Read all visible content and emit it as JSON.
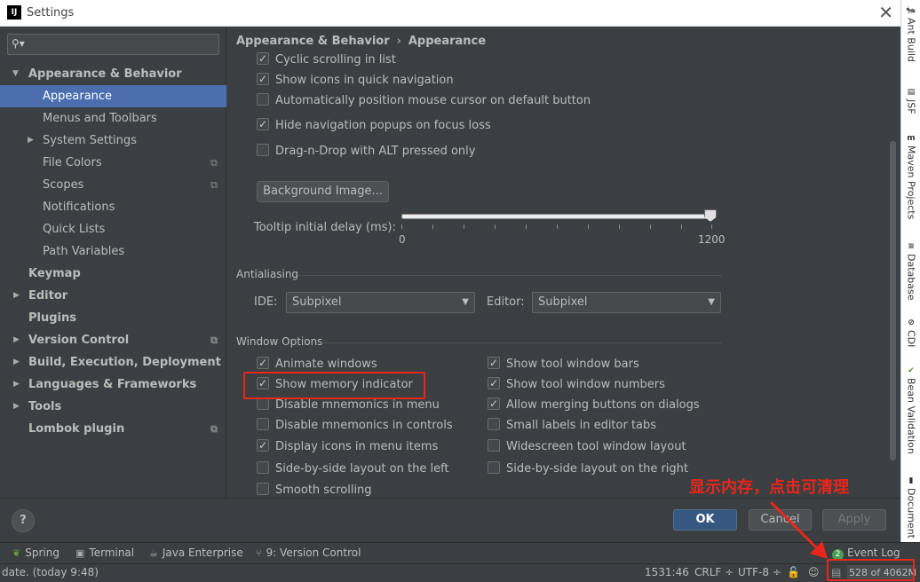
{
  "window": {
    "title": "Settings",
    "icon": "intellij-icon"
  },
  "right_tool_strip": [
    {
      "label": "Ant Build",
      "icon": "ant-icon"
    },
    {
      "label": "JSF",
      "icon": "jsf-icon"
    },
    {
      "label": "Maven Projects",
      "icon": "maven-icon"
    },
    {
      "label": "Database",
      "icon": "database-icon"
    },
    {
      "label": "CDI",
      "icon": "cdi-icon"
    },
    {
      "label": "Bean Validation",
      "icon": "bean-validation-icon"
    },
    {
      "label": "Document",
      "icon": "document-icon"
    }
  ],
  "search": {
    "placeholder": "",
    "value": ""
  },
  "sidebar": {
    "items": [
      {
        "label": "Appearance & Behavior"
      },
      {
        "label": "Appearance"
      },
      {
        "label": "Menus and Toolbars"
      },
      {
        "label": "System Settings"
      },
      {
        "label": "File Colors"
      },
      {
        "label": "Scopes"
      },
      {
        "label": "Notifications"
      },
      {
        "label": "Quick Lists"
      },
      {
        "label": "Path Variables"
      },
      {
        "label": "Keymap"
      },
      {
        "label": "Editor"
      },
      {
        "label": "Plugins"
      },
      {
        "label": "Version Control"
      },
      {
        "label": "Build, Execution, Deployment"
      },
      {
        "label": "Languages & Frameworks"
      },
      {
        "label": "Tools"
      },
      {
        "label": "Lombok plugin"
      }
    ]
  },
  "breadcrumb": {
    "parent": "Appearance & Behavior",
    "separator": "›",
    "current": "Appearance"
  },
  "ui_options": [
    {
      "label": "Cyclic scrolling in list",
      "checked": true
    },
    {
      "label": "Show icons in quick navigation",
      "checked": true
    },
    {
      "label": "Automatically position mouse cursor on default button",
      "checked": false
    },
    {
      "label": "Hide navigation popups on focus loss",
      "checked": true
    },
    {
      "label": "Drag-n-Drop with ALT pressed only",
      "checked": false
    }
  ],
  "background_image_button": "Background Image...",
  "tooltip": {
    "label": "Tooltip initial delay (ms):",
    "min": "0",
    "max": "1200",
    "value": 1200
  },
  "antialiasing": {
    "title": "Antialiasing",
    "ide_label": "IDE:",
    "ide_value": "Subpixel",
    "editor_label": "Editor:",
    "editor_value": "Subpixel"
  },
  "window_options": {
    "title": "Window Options",
    "left": [
      {
        "label": "Animate windows",
        "checked": true
      },
      {
        "label": "Show memory indicator",
        "checked": true
      },
      {
        "label": "Disable mnemonics in menu",
        "checked": false
      },
      {
        "label": "Disable mnemonics in controls",
        "checked": false
      },
      {
        "label": "Display icons in menu items",
        "checked": true
      },
      {
        "label": "Side-by-side layout on the left",
        "checked": false
      },
      {
        "label": "Smooth scrolling",
        "checked": false
      }
    ],
    "right": [
      {
        "label": "Show tool window bars",
        "checked": true
      },
      {
        "label": "Show tool window numbers",
        "checked": true
      },
      {
        "label": "Allow merging buttons on dialogs",
        "checked": true
      },
      {
        "label": "Small labels in editor tabs",
        "checked": false
      },
      {
        "label": "Widescreen tool window layout",
        "checked": false
      },
      {
        "label": "Side-by-side layout on the right",
        "checked": false
      }
    ]
  },
  "buttons": {
    "help": "?",
    "ok": "OK",
    "cancel": "Cancel",
    "apply": "Apply"
  },
  "tool_windows": [
    {
      "label": "Spring",
      "icon": "spring-icon"
    },
    {
      "label": "Terminal",
      "icon": "terminal-icon"
    },
    {
      "label": "Java Enterprise",
      "icon": "java-enterprise-icon"
    },
    {
      "label": "9: Version Control",
      "icon": "version-control-icon"
    },
    {
      "label": "Event Log",
      "badge": "2"
    }
  ],
  "status": {
    "message": "date. (today 9:48)",
    "position": "1531:46",
    "line_separator": "CRLF ÷",
    "encoding": "UTF-8 ÷",
    "memory": "528 of 4062M"
  },
  "annotation": {
    "text": "显示内存，点击可清理",
    "color": "#e8261c"
  },
  "colors": {
    "selection": "#4b6eaf",
    "ok_button": "#365880",
    "background": "#3c3f41",
    "annotation": "#e8261c"
  }
}
